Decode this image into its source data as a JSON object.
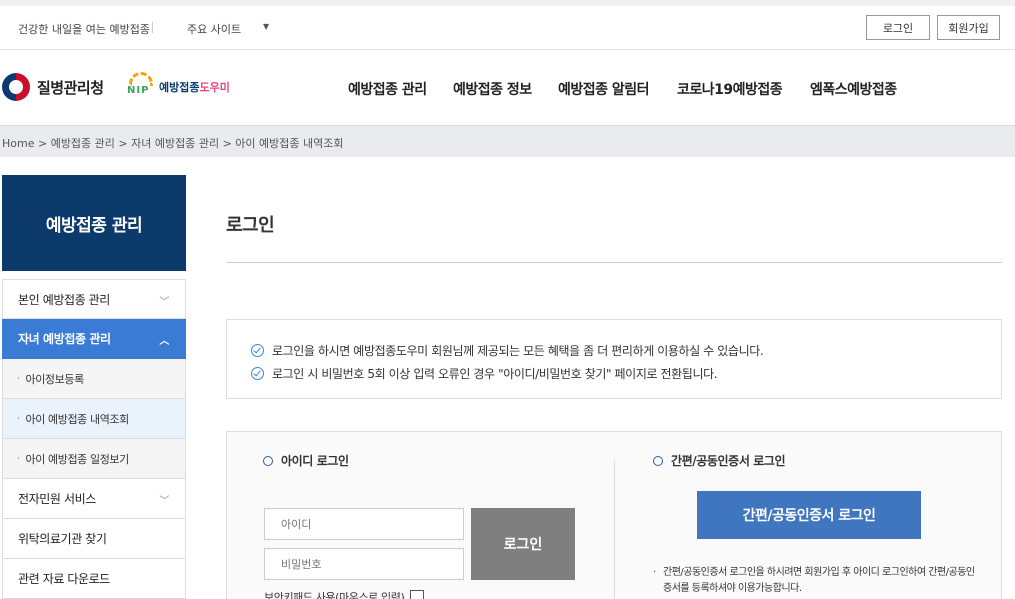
{
  "topbar": {
    "tagline": "건강한 내일을 여는 예방접종",
    "sites_label": "주요 사이트",
    "login_label": "로그인",
    "join_label": "회원가입"
  },
  "header": {
    "org_name": "질병관리청",
    "helper_logo_prefix": "예방접종",
    "helper_logo_suffix": "도우미",
    "helper_logo_mark": "NIP",
    "nav": [
      "예방접종 관리",
      "예방접종 정보",
      "예방접종 알림터",
      "코로나19예방접종",
      "엠폭스예방접종"
    ]
  },
  "breadcrumb": "Home  > 예방접종 관리  > 자녀 예방접종 관리  > 아이 예방접종 내역조회",
  "sidebar": {
    "title": "예방접종 관리",
    "items": [
      {
        "label": "본인 예방접종 관리"
      },
      {
        "label": "자녀 예방접종 관리"
      },
      {
        "label": "아이정보등록"
      },
      {
        "label": "아이 예방접종 내역조회"
      },
      {
        "label": "아이 예방접종 일정보기"
      },
      {
        "label": "전자민원 서비스"
      },
      {
        "label": "위탁의료기관 찾기"
      },
      {
        "label": "관련 자료 다운로드"
      }
    ]
  },
  "main": {
    "title": "로그인",
    "notices": [
      "로그인을 하시면 예방접종도우미 회원님께 제공되는 모든 혜택을 좀 더 편리하게 이용하실 수 있습니다.",
      "로그인 시 비밀번호 5회 이상 입력 오류인 경우 \"아이디/비밀번호 찾기\" 페이지로 전환됩니다."
    ],
    "id_login": {
      "title": "아이디 로그인",
      "id_placeholder": "아이디",
      "pw_placeholder": "비밀번호",
      "submit_label": "로그인",
      "keypad_label": "보안키패드 사용(마우스로 입력)"
    },
    "cert_login": {
      "title": "간편/공동인증서 로그인",
      "button_label": "간편/공동인증서 로그인",
      "note": "간편/공동인증서 로그인을 하시려면 회원가입 후 아이디 로그인하여 간편/공동인증서를 등록하셔야 이용가능합니다."
    }
  }
}
